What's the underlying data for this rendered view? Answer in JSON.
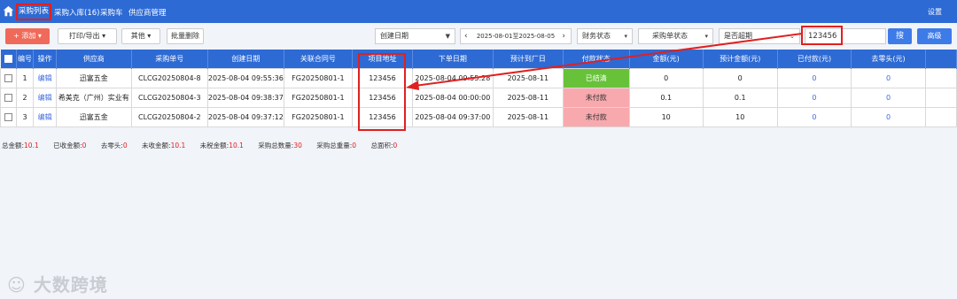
{
  "nav": {
    "tabs": [
      "采购列表",
      "采购入库(16)",
      "采购车",
      "供应商管理"
    ],
    "settings": "设置"
  },
  "toolbar": {
    "add": "+ 添加",
    "add_caret": "▾",
    "print": "打印/导出",
    "other": "其他",
    "batch_delete": "批量删除",
    "date_type": "创建日期",
    "date_range": "2025-08-01至2025-08-05",
    "finance": "财务状态",
    "order_status": "采购单状态",
    "overdue": "是否超期",
    "search_value": "123456",
    "search_btn": "搜",
    "advanced": "高级",
    "prev": "‹",
    "next": "›"
  },
  "table": {
    "headers": [
      "编号",
      "操作",
      "供应商",
      "采购单号",
      "创建日期",
      "关联合同号",
      "项目地址",
      "下单日期",
      "预计到厂日",
      "付款状态",
      "金额(元)",
      "预计金额(元)",
      "已付款(元)",
      "去零头(元)"
    ],
    "rows": [
      {
        "no": "1",
        "op": "编辑",
        "supplier": "迅富五金",
        "order_no": "CLCG20250804-8",
        "created": "2025-08-04 09:55:36",
        "contract": "FG20250801-1",
        "address": "123456",
        "ordered": "2025-08-04 09:55:28",
        "eta": "2025-08-11",
        "pay": "已结清",
        "amount": "0",
        "est": "0",
        "paid": "0",
        "rounding": "0"
      },
      {
        "no": "2",
        "op": "编辑",
        "supplier": "希美克（广州）实业有",
        "order_no": "CLCG20250804-3",
        "created": "2025-08-04 09:38:37",
        "contract": "FG20250801-1",
        "address": "123456",
        "ordered": "2025-08-04 00:00:00",
        "eta": "2025-08-11",
        "pay": "未付款",
        "amount": "0.1",
        "est": "0.1",
        "paid": "0",
        "rounding": "0"
      },
      {
        "no": "3",
        "op": "编辑",
        "supplier": "迅富五金",
        "order_no": "CLCG20250804-2",
        "created": "2025-08-04 09:37:12",
        "contract": "FG20250801-1",
        "address": "123456",
        "ordered": "2025-08-04 09:37:00",
        "eta": "2025-08-11",
        "pay": "未付款",
        "amount": "10",
        "est": "10",
        "paid": "0",
        "rounding": "0"
      }
    ]
  },
  "summary": {
    "total_label": "总金额:",
    "total": "10.1",
    "received_label": "已收金额:",
    "received": "0",
    "rounding_label": "去零头:",
    "rounding": "0",
    "unreceived_label": "未收金额:",
    "unreceived": "10.1",
    "pretax_label": "未税金额:",
    "pretax": "10.1",
    "qty_label": "采购总数量:",
    "qty": "30",
    "weight_label": "采购总重量:",
    "weight": "0",
    "area_label": "总面积:",
    "area": "0"
  },
  "watermark": "大数跨境",
  "colors": {
    "nav": "#2d6ad4",
    "highlight": "#e02020",
    "paid": "#67c23a",
    "unpaid": "#f8a9ad"
  }
}
